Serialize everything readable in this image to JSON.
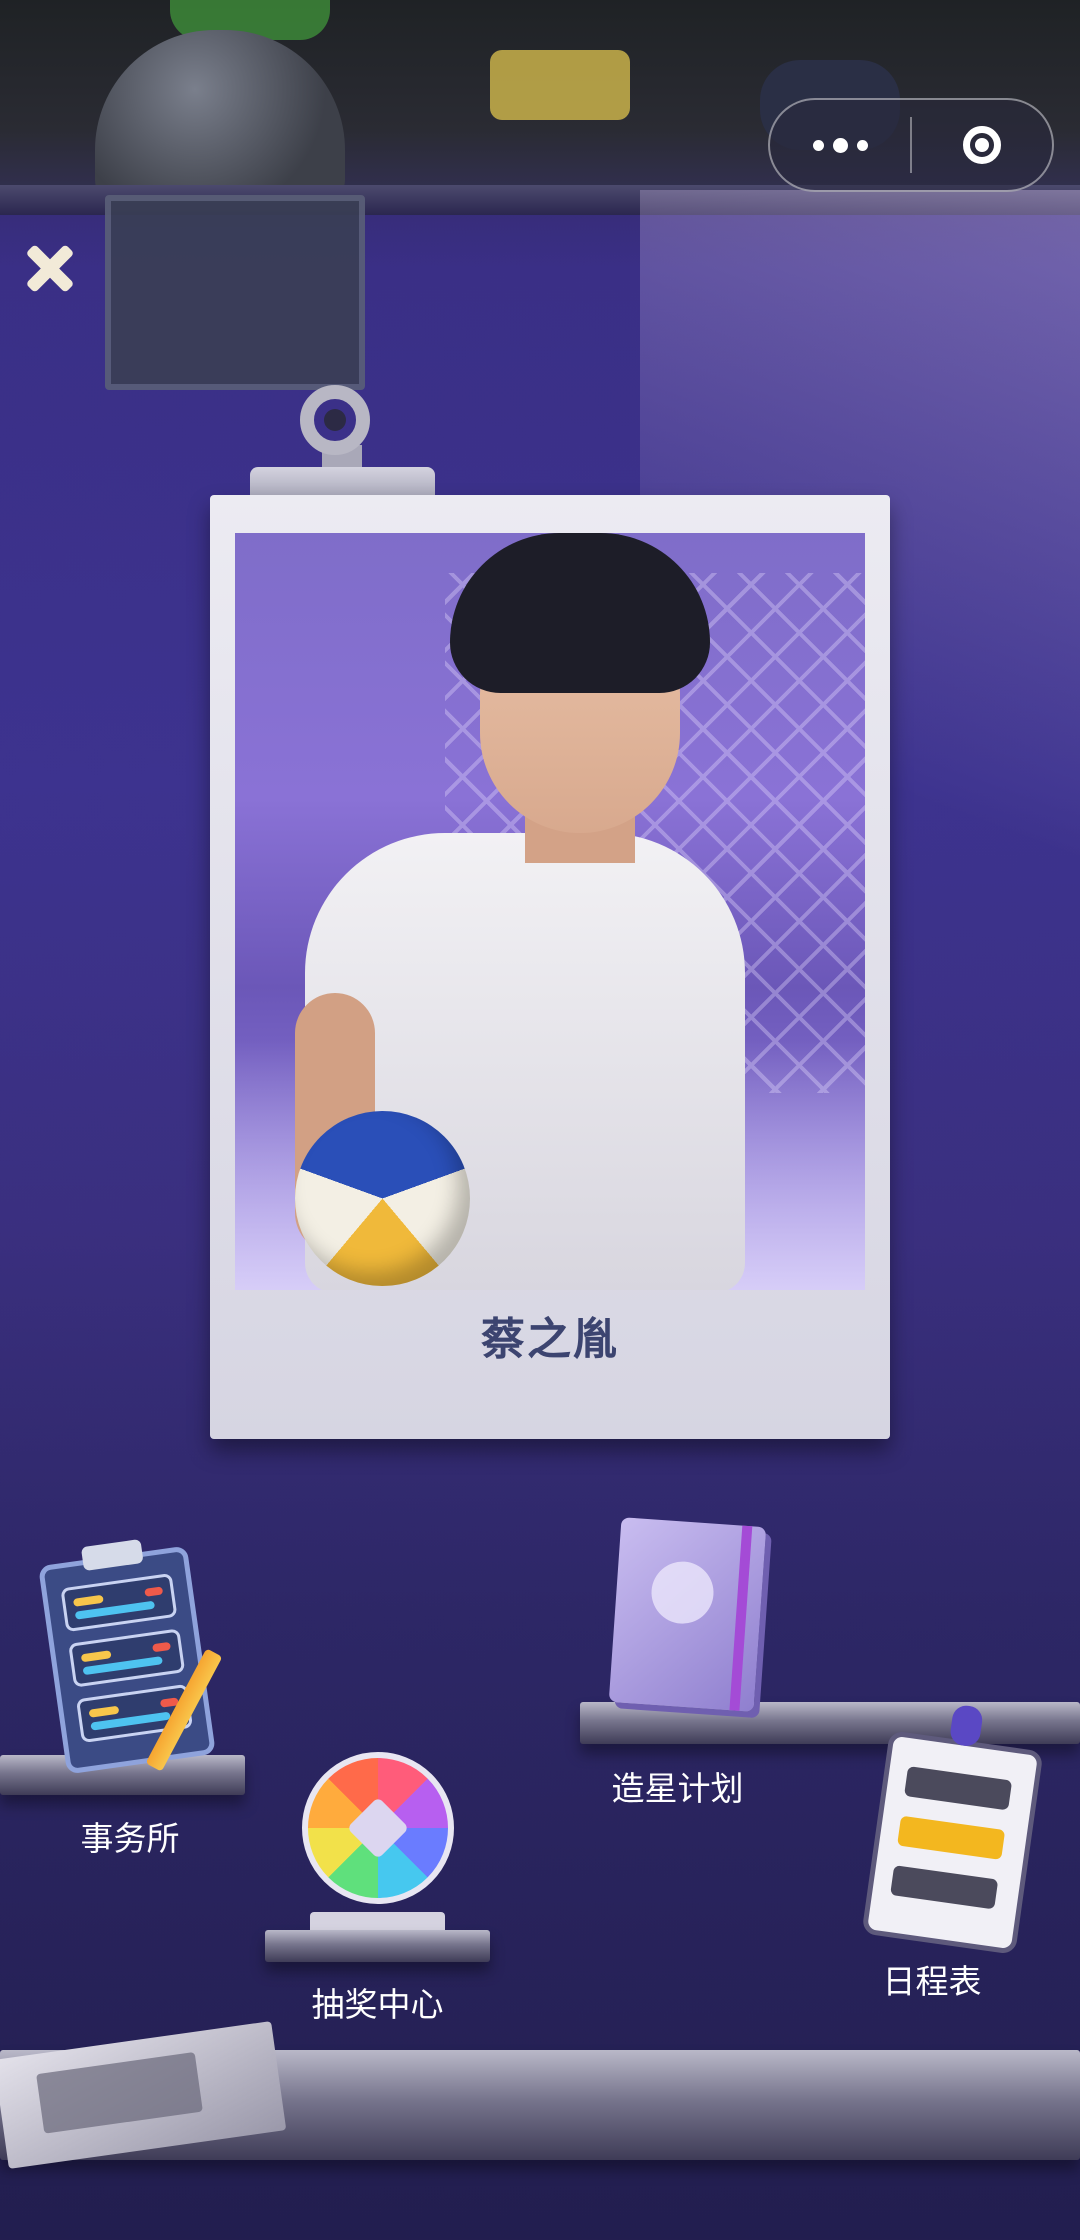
{
  "character": {
    "name": "蔡之胤"
  },
  "menu": {
    "agency": "事务所",
    "star_plan": "造星计划",
    "lottery": "抽奖中心",
    "schedule": "日程表"
  },
  "icons": {
    "close": "close-icon",
    "more": "more-dots-icon",
    "exit": "target-circle-icon"
  }
}
